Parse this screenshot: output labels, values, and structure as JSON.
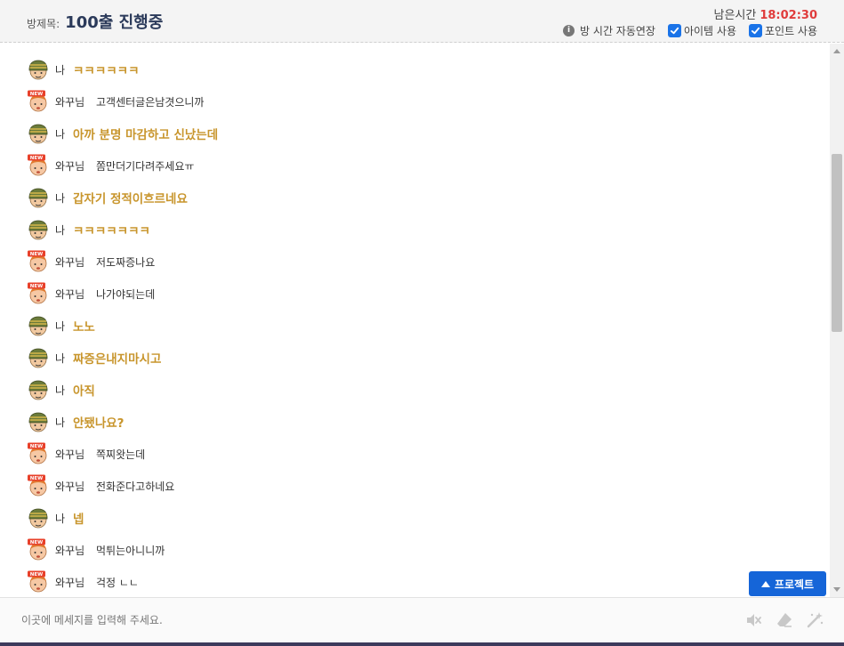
{
  "header": {
    "room_label": "방제목:",
    "room_title": "100출 진행중",
    "timer_label": "남은시간",
    "timer_value": "18:02:30",
    "auto_extend_label": "방 시간 자동연장",
    "item_use_label": "아이템 사용",
    "point_use_label": "포인트 사용"
  },
  "messages": [
    {
      "who": "me",
      "sender": "나",
      "text": "ㅋㅋㅋㅋㅋㅋ"
    },
    {
      "who": "other",
      "sender": "와꾸님",
      "text": "고객센터글은남겻으니까"
    },
    {
      "who": "me",
      "sender": "나",
      "text": "아까 분명 마감하고 신났는데"
    },
    {
      "who": "other",
      "sender": "와꾸님",
      "text": "쫌만더기다려주세요ㅠ"
    },
    {
      "who": "me",
      "sender": "나",
      "text": "갑자기 정적이흐르네요"
    },
    {
      "who": "me",
      "sender": "나",
      "text": "ㅋㅋㅋㅋㅋㅋㅋ"
    },
    {
      "who": "other",
      "sender": "와꾸님",
      "text": "저도짜증나요"
    },
    {
      "who": "other",
      "sender": "와꾸님",
      "text": "나가야되는데"
    },
    {
      "who": "me",
      "sender": "나",
      "text": "노노"
    },
    {
      "who": "me",
      "sender": "나",
      "text": "짜증은내지마시고"
    },
    {
      "who": "me",
      "sender": "나",
      "text": "아직"
    },
    {
      "who": "me",
      "sender": "나",
      "text": "안됐나요?"
    },
    {
      "who": "other",
      "sender": "와꾸님",
      "text": "쪽찌왓는데"
    },
    {
      "who": "other",
      "sender": "와꾸님",
      "text": "전화준다고하네요"
    },
    {
      "who": "me",
      "sender": "나",
      "text": "넵"
    },
    {
      "who": "other",
      "sender": "와꾸님",
      "text": "먹튀는아니니까"
    },
    {
      "who": "other",
      "sender": "와꾸님",
      "text": "걱정 ㄴㄴ"
    }
  ],
  "project_button": "프로젝트",
  "input": {
    "placeholder": "이곳에 메세지를 입력해 주세요."
  },
  "colors": {
    "accent": "#1565d8",
    "my_message": "#c8952c",
    "timer": "#e03c3c"
  }
}
